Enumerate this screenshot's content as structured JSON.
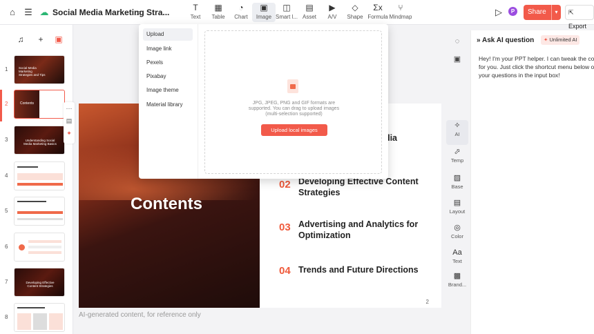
{
  "header": {
    "doc_title": "Social Media Marketing Stra...",
    "toolbar": [
      {
        "label": "Text",
        "icon": "text-icon"
      },
      {
        "label": "Table",
        "icon": "table-icon"
      },
      {
        "label": "Chart",
        "icon": "chart-icon"
      },
      {
        "label": "Image",
        "icon": "image-icon"
      },
      {
        "label": "Smart l...",
        "icon": "smart-layout-icon"
      },
      {
        "label": "Asset",
        "icon": "asset-icon"
      },
      {
        "label": "A/V",
        "icon": "av-icon"
      },
      {
        "label": "Shape",
        "icon": "shape-icon"
      },
      {
        "label": "Formula",
        "icon": "formula-icon"
      },
      {
        "label": "Mindmap",
        "icon": "mindmap-icon"
      }
    ],
    "avatar_letter": "P",
    "share_label": "Share",
    "export_label": "Export"
  },
  "thumbnails": {
    "numbers": [
      "1",
      "2",
      "3",
      "4",
      "5",
      "6",
      "7",
      "8"
    ],
    "slide1_text": "Social Media Marketing Strategies and Tips",
    "slide2_text": "Contents",
    "slide3_text": "Understanding Social Media Marketing Basics",
    "slide7_text": "Developing Effective Content Strategies"
  },
  "dropdown": {
    "menu": [
      "Upload",
      "Image link",
      "Pexels",
      "Pixabay",
      "Image theme",
      "Material library"
    ],
    "upload_hint_1": "JPG, JPEG, PNG and GIF formats are",
    "upload_hint_2": "supported. You can drag to upload images",
    "upload_hint_3": "(multi-selection supported)",
    "upload_button": "Upload local images"
  },
  "slide": {
    "title": "Contents",
    "item1_num": "",
    "item1_text": "edia",
    "item2_num": "02",
    "item2_text": "Developing Effective Content Strategies",
    "item3_num": "03",
    "item3_text": "Advertising and Analytics for Optimization",
    "item4_num": "04",
    "item4_text": "Trends and Future Directions",
    "page_number": "2"
  },
  "footer_note": "AI-generated content, for reference only",
  "rail": [
    {
      "label": "AI",
      "icon": "ai-icon"
    },
    {
      "label": "Temp",
      "icon": "template-icon"
    },
    {
      "label": "Base",
      "icon": "base-icon"
    },
    {
      "label": "Layout",
      "icon": "layout-icon"
    },
    {
      "label": "Color",
      "icon": "color-icon"
    },
    {
      "label": "Text",
      "icon": "text-style-icon"
    },
    {
      "label": "Brand...",
      "icon": "brand-icon"
    }
  ],
  "ai_panel": {
    "title": "Ask AI question",
    "badge": "Unlimited AI",
    "message_line1": "Hey! I'm your PPT helper. I can tweak the content",
    "message_line2": "for you. Just click the shortcut menu below or post",
    "message_line3": "your questions in the input box!"
  },
  "colors": {
    "accent": "#f25a4a",
    "number_accent": "#ef5a3b"
  }
}
